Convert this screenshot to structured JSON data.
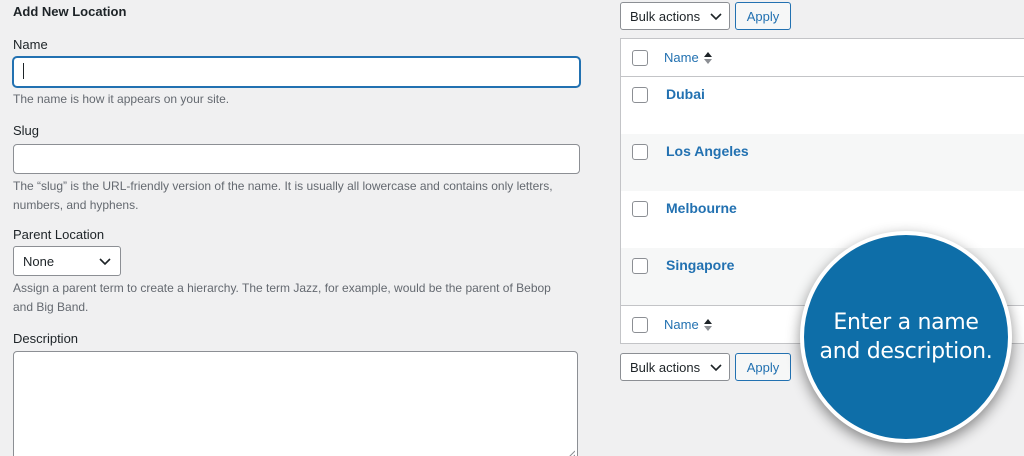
{
  "form": {
    "heading": "Add New Location",
    "name_label": "Name",
    "name_value": "",
    "name_help": "The name is how it appears on your site.",
    "slug_label": "Slug",
    "slug_value": "",
    "slug_help": "The “slug” is the URL-friendly version of the name. It is usually all lowercase and contains only letters, numbers, and hyphens.",
    "parent_label": "Parent Location",
    "parent_selected": "None",
    "parent_help": "Assign a parent term to create a hierarchy. The term Jazz, for example, would be the parent of Bebop and Big Band.",
    "description_label": "Description",
    "description_value": ""
  },
  "list": {
    "bulk_actions_label": "Bulk actions",
    "apply_label": "Apply",
    "column_name": "Name",
    "rows": [
      "Dubai",
      "Los Angeles",
      "Melbourne",
      "Singapore"
    ]
  },
  "callout": {
    "text": "Enter a name and description."
  },
  "colors": {
    "accent": "#2271b1",
    "callout_bg": "#0e6ea8",
    "background": "#f0f0f1"
  },
  "icons": {
    "select_chevron": "chevron-down-icon",
    "sort": "sort-arrows-icon"
  }
}
